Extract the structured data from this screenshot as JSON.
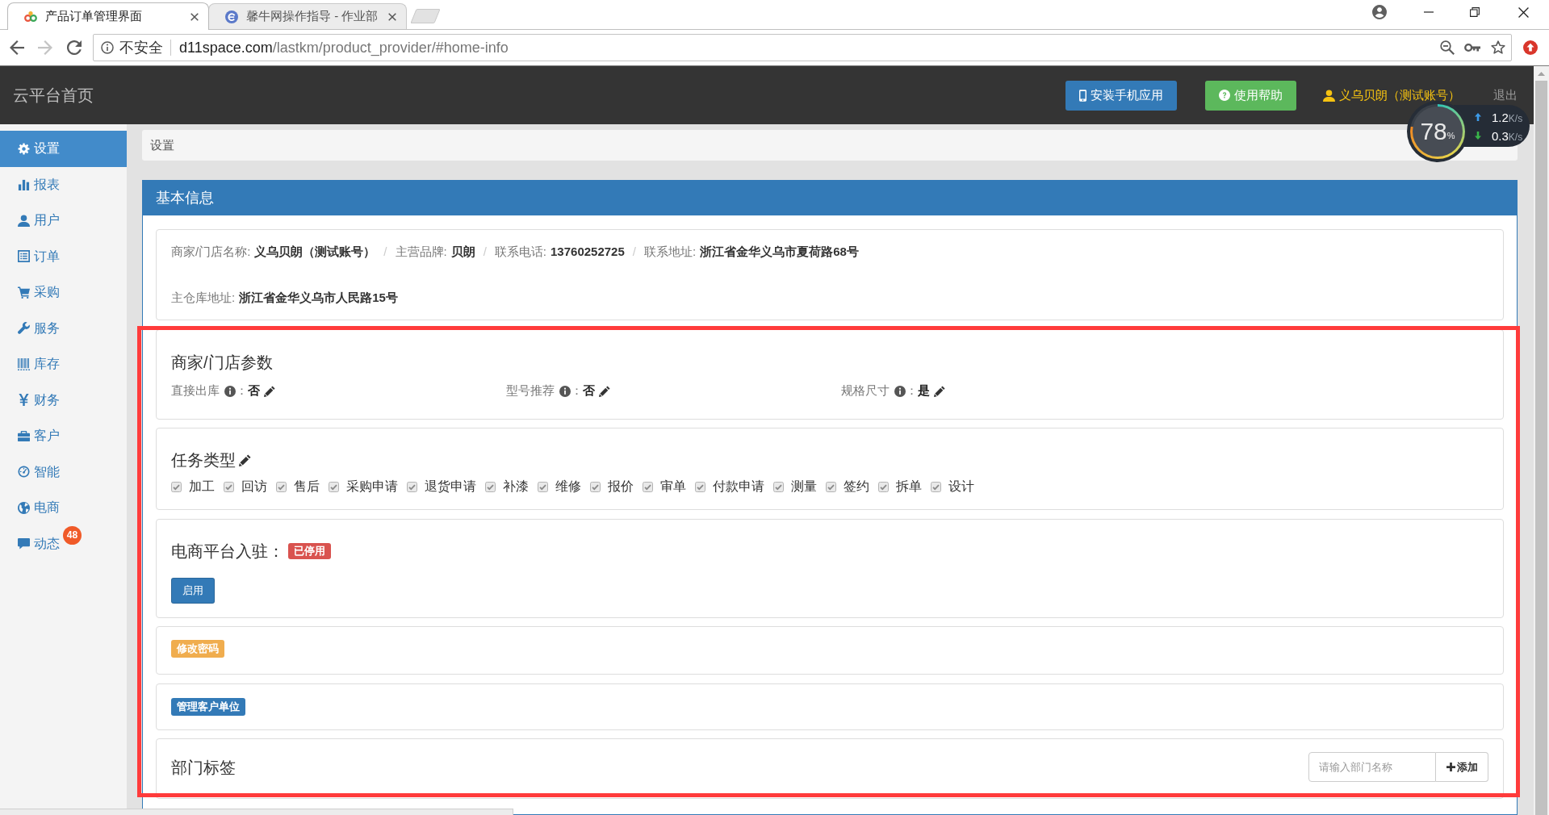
{
  "browser": {
    "tabs": [
      {
        "title": "产品订单管理界面",
        "selected": true
      },
      {
        "title": "馨牛网操作指导 - 作业部",
        "selected": false
      }
    ],
    "address": {
      "security": "不安全",
      "host": "d11space.com",
      "path": "/lastkm/product_provider/#home-info"
    }
  },
  "header": {
    "title": "云平台首页",
    "buttons": [
      {
        "label": "安装手机应用",
        "kind": "primary"
      },
      {
        "label": "使用帮助",
        "kind": "success"
      }
    ],
    "user": "义乌贝朗（测试账号）",
    "logout": "退出"
  },
  "speed_widget": {
    "percent": "78",
    "percent_sign": "%",
    "rates": [
      {
        "kind": "upload",
        "value": "1.2",
        "unit": "K/s"
      },
      {
        "kind": "download",
        "value": "0.3",
        "unit": "K/s"
      }
    ]
  },
  "sidebar": {
    "items": [
      {
        "label": "设置",
        "selected": true
      },
      {
        "label": "报表",
        "selected": false
      },
      {
        "label": "用户",
        "selected": false
      },
      {
        "label": "订单",
        "selected": false
      },
      {
        "label": "采购",
        "selected": false
      },
      {
        "label": "服务",
        "selected": false
      },
      {
        "label": "库存",
        "selected": false
      },
      {
        "label": "财务",
        "selected": false
      },
      {
        "label": "客户",
        "selected": false
      },
      {
        "label": "智能",
        "selected": false
      },
      {
        "label": "电商",
        "selected": false
      },
      {
        "label": "动态",
        "selected": false,
        "badge": "48"
      }
    ]
  },
  "breadcrumb": "设置",
  "panel": {
    "title": "基本信息",
    "info_rows": [
      [
        {
          "label": "商家/门店名称:",
          "value": "义乌贝朗（测试账号）"
        },
        {
          "separator": "/",
          "label": "主营品牌:",
          "value": "贝朗"
        },
        {
          "separator": "/",
          "label": "联系电话:",
          "value": "13760252725"
        },
        {
          "separator": "/",
          "label": "联系地址:",
          "value": "浙江省金华义乌市夏荷路68号"
        }
      ],
      [
        {
          "label": "主仓库地址:",
          "value": "浙江省金华义乌市人民路15号"
        }
      ]
    ],
    "merchant_params": {
      "title": "商家/门店参数",
      "items": [
        {
          "label": "直接出库",
          "colon": "：",
          "value": "否"
        },
        {
          "label": "型号推荐",
          "colon": "：",
          "value": "否"
        },
        {
          "label": "规格尺寸",
          "colon": "：",
          "value": "是"
        }
      ]
    },
    "task_types": {
      "title": "任务类型",
      "disabled": true,
      "items": [
        {
          "label": "加工",
          "checked": true
        },
        {
          "label": "回访",
          "checked": true
        },
        {
          "label": "售后",
          "checked": true
        },
        {
          "label": "采购申请",
          "checked": true
        },
        {
          "label": "退货申请",
          "checked": true
        },
        {
          "label": "补漆",
          "checked": true
        },
        {
          "label": "维修",
          "checked": true
        },
        {
          "label": "报价",
          "checked": true
        },
        {
          "label": "审单",
          "checked": true
        },
        {
          "label": "付款申请",
          "checked": true
        },
        {
          "label": "测量",
          "checked": true
        },
        {
          "label": "签约",
          "checked": true
        },
        {
          "label": "拆单",
          "checked": true
        },
        {
          "label": "设计",
          "checked": true
        }
      ]
    },
    "ecommerce": {
      "title": "电商平台入驻：",
      "status": {
        "label": "已停用",
        "kind": "danger"
      },
      "button": {
        "label": "启用",
        "kind": "primary"
      }
    },
    "actions": [
      {
        "label": "修改密码",
        "kind": "warning"
      },
      {
        "label": "管理客户单位",
        "kind": "primary"
      }
    ],
    "departments": {
      "title": "部门标签",
      "input": {
        "placeholder": "请输入部门名称"
      },
      "add_button": "添加"
    }
  }
}
